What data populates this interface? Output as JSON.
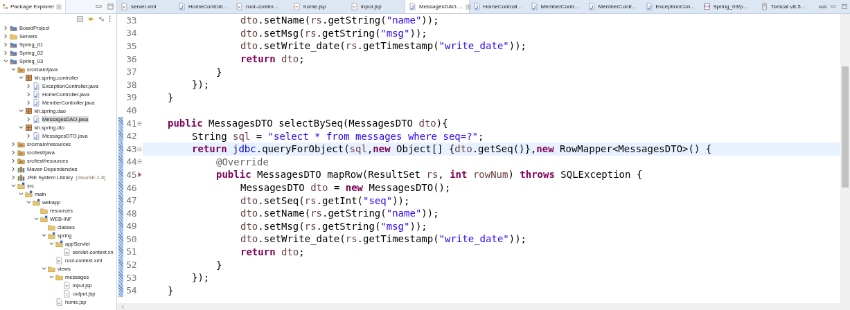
{
  "explorer": {
    "title": "Package Explorer",
    "tree": [
      {
        "label": "BoardProject",
        "kind": "project",
        "expanded": false,
        "selected": false
      },
      {
        "label": "Servers",
        "kind": "folder",
        "expanded": false,
        "selected": false
      },
      {
        "label": "Spring_01",
        "kind": "project",
        "expanded": false,
        "selected": false
      },
      {
        "label": "Spring_02",
        "kind": "project",
        "expanded": false,
        "selected": false
      },
      {
        "label": "Spring_03",
        "kind": "project",
        "expanded": true,
        "selected": false,
        "children": [
          {
            "label": "src/main/java",
            "kind": "source",
            "expanded": true,
            "selected": false,
            "children": [
              {
                "label": "kh.spring.controller",
                "kind": "package",
                "expanded": true,
                "selected": false,
                "children": [
                  {
                    "label": "ExceptionController.java",
                    "kind": "java",
                    "expanded": false,
                    "selected": false
                  },
                  {
                    "label": "HomeController.java",
                    "kind": "java",
                    "expanded": false,
                    "selected": false
                  },
                  {
                    "label": "MemberController.java",
                    "kind": "java",
                    "expanded": false,
                    "selected": false
                  }
                ]
              },
              {
                "label": "kh.spring.dao",
                "kind": "package",
                "expanded": true,
                "selected": false,
                "children": [
                  {
                    "label": "MessagesDAO.java",
                    "kind": "java",
                    "expanded": false,
                    "selected": true
                  }
                ]
              },
              {
                "label": "kh.spring.dto",
                "kind": "package",
                "expanded": true,
                "selected": false,
                "children": [
                  {
                    "label": "MessagesDTO.java",
                    "kind": "java",
                    "expanded": false,
                    "selected": false
                  }
                ]
              }
            ]
          },
          {
            "label": "src/main/resources",
            "kind": "source",
            "expanded": false,
            "selected": false
          },
          {
            "label": "src/test/java",
            "kind": "source",
            "expanded": false,
            "selected": false
          },
          {
            "label": "src/test/resources",
            "kind": "source",
            "expanded": false,
            "selected": false
          },
          {
            "label": "Maven Dependencies",
            "kind": "library",
            "expanded": false,
            "selected": false
          },
          {
            "label": "JRE System Library",
            "note": "[JavaSE-1.8]",
            "kind": "library",
            "expanded": false,
            "selected": false
          },
          {
            "label": "src",
            "kind": "webfolder",
            "expanded": true,
            "selected": false,
            "children": [
              {
                "label": "main",
                "kind": "webfolder",
                "expanded": true,
                "selected": false,
                "children": [
                  {
                    "label": "webapp",
                    "kind": "webfolder",
                    "expanded": true,
                    "selected": false,
                    "children": [
                      {
                        "label": "resources",
                        "kind": "folder",
                        "selected": false
                      },
                      {
                        "label": "WEB-INF",
                        "kind": "webfolder",
                        "expanded": true,
                        "selected": false,
                        "children": [
                          {
                            "label": "classes",
                            "kind": "folder",
                            "selected": false
                          },
                          {
                            "label": "spring",
                            "kind": "webfolder",
                            "expanded": true,
                            "selected": false,
                            "children": [
                              {
                                "label": "appServlet",
                                "kind": "webfolder",
                                "expanded": true,
                                "selected": false,
                                "children": [
                                  {
                                    "label": "servlet-context.xn",
                                    "kind": "xml",
                                    "selected": false
                                  }
                                ]
                              },
                              {
                                "label": "root-context.xml",
                                "kind": "xml",
                                "selected": false
                              }
                            ]
                          },
                          {
                            "label": "views",
                            "kind": "folder",
                            "expanded": true,
                            "selected": false,
                            "children": [
                              {
                                "label": "messages",
                                "kind": "folder",
                                "expanded": true,
                                "selected": false,
                                "children": [
                                  {
                                    "label": "input.jsp",
                                    "kind": "jsp",
                                    "selected": false
                                  },
                                  {
                                    "label": "output.jsp",
                                    "kind": "jsp",
                                    "selected": false
                                  }
                                ]
                              },
                              {
                                "label": "home.jsp",
                                "kind": "jsp",
                                "selected": false
                              }
                            ]
                          }
                        ]
                      }
                    ]
                  }
                ]
              }
            ]
          }
        ]
      }
    ]
  },
  "editor": {
    "tabs": [
      {
        "label": "server.xml",
        "kind": "xml",
        "selected": false
      },
      {
        "label": "HomeControll...",
        "kind": "java",
        "selected": false
      },
      {
        "label": "root-contex...",
        "kind": "xml",
        "selected": false
      },
      {
        "label": "home.jsp",
        "kind": "jsp",
        "selected": false
      },
      {
        "label": "input.jsp",
        "kind": "jsp",
        "selected": false
      },
      {
        "label": "MessagesDAO....",
        "kind": "java",
        "selected": true
      },
      {
        "label": "HomeControll...",
        "kind": "java",
        "selected": false
      },
      {
        "label": "MemberContr...",
        "kind": "java",
        "selected": false
      },
      {
        "label": "MemberContr...",
        "kind": "java",
        "selected": false
      },
      {
        "label": "ExceptionCon...",
        "kind": "java",
        "selected": false
      },
      {
        "label": "Spring_03/p...",
        "kind": "maven",
        "selected": false
      },
      {
        "label": "Tomcat v8.5...",
        "kind": "server",
        "selected": false
      }
    ],
    "overflow": {
      "glyph": "»",
      "count": "29"
    },
    "lines": [
      {
        "number": "33",
        "current": false,
        "changed": false,
        "foldable": false,
        "overrides": false,
        "tokens": [
          {
            "kind": "var",
            "text": "\t\t\t\tdto"
          },
          {
            "kind": "plain",
            "text": ".setName("
          },
          {
            "kind": "var",
            "text": "rs"
          },
          {
            "kind": "plain",
            "text": ".getString("
          },
          {
            "kind": "str",
            "text": "\"name\""
          },
          {
            "kind": "plain",
            "text": "));"
          }
        ]
      },
      {
        "number": "34",
        "current": false,
        "changed": false,
        "foldable": false,
        "overrides": false,
        "tokens": [
          {
            "kind": "var",
            "text": "\t\t\t\tdto"
          },
          {
            "kind": "plain",
            "text": ".setMsg("
          },
          {
            "kind": "var",
            "text": "rs"
          },
          {
            "kind": "plain",
            "text": ".getString("
          },
          {
            "kind": "str",
            "text": "\"msg\""
          },
          {
            "kind": "plain",
            "text": "));"
          }
        ]
      },
      {
        "number": "35",
        "current": false,
        "changed": false,
        "foldable": false,
        "overrides": false,
        "tokens": [
          {
            "kind": "var",
            "text": "\t\t\t\tdto"
          },
          {
            "kind": "plain",
            "text": ".setWrite_date("
          },
          {
            "kind": "var",
            "text": "rs"
          },
          {
            "kind": "plain",
            "text": ".getTimestamp("
          },
          {
            "kind": "str",
            "text": "\"write_date\""
          },
          {
            "kind": "plain",
            "text": "));"
          }
        ]
      },
      {
        "number": "36",
        "current": false,
        "changed": false,
        "foldable": false,
        "overrides": false,
        "tokens": [
          {
            "kind": "kw",
            "text": "\t\t\t\treturn "
          },
          {
            "kind": "var",
            "text": "dto"
          },
          {
            "kind": "plain",
            "text": ";"
          }
        ]
      },
      {
        "number": "37",
        "current": false,
        "changed": false,
        "foldable": false,
        "overrides": false,
        "tokens": [
          {
            "kind": "plain",
            "text": "\t\t\t}"
          }
        ]
      },
      {
        "number": "38",
        "current": false,
        "changed": false,
        "foldable": false,
        "overrides": false,
        "tokens": [
          {
            "kind": "plain",
            "text": "\t\t});"
          }
        ]
      },
      {
        "number": "39",
        "current": false,
        "changed": false,
        "foldable": false,
        "overrides": false,
        "tokens": [
          {
            "kind": "plain",
            "text": "\t}"
          }
        ]
      },
      {
        "number": "40",
        "current": false,
        "changed": false,
        "foldable": false,
        "overrides": false
      },
      {
        "number": "41",
        "current": false,
        "changed": true,
        "foldable": true,
        "overrides": false,
        "tokens": [
          {
            "kind": "kw",
            "text": "\tpublic"
          },
          {
            "kind": "plain",
            "text": " MessagesDTO selectBySeq(MessagesDTO "
          },
          {
            "kind": "var",
            "text": "dto"
          },
          {
            "kind": "plain",
            "text": "){"
          }
        ]
      },
      {
        "number": "42",
        "current": false,
        "changed": true,
        "foldable": false,
        "overrides": false,
        "tokens": [
          {
            "kind": "plain",
            "text": "\t\tString "
          },
          {
            "kind": "var",
            "text": "sql"
          },
          {
            "kind": "plain",
            "text": " = "
          },
          {
            "kind": "str",
            "text": "\"select * from messages where seq=?\""
          },
          {
            "kind": "plain",
            "text": ";"
          }
        ]
      },
      {
        "number": "43",
        "current": true,
        "changed": true,
        "foldable": true,
        "overrides": false,
        "tokens": [
          {
            "kind": "kw",
            "text": "\t\treturn "
          },
          {
            "kind": "field",
            "text": "jdbc"
          },
          {
            "kind": "plain",
            "text": ".queryForObject("
          },
          {
            "kind": "var",
            "text": "sql"
          },
          {
            "kind": "plain",
            "text": ","
          },
          {
            "kind": "kw",
            "text": "new"
          },
          {
            "kind": "plain",
            "text": " Object[] {"
          },
          {
            "kind": "var",
            "text": "dto"
          },
          {
            "kind": "plain",
            "text": ".getSeq()},"
          },
          {
            "kind": "kw",
            "text": "new"
          },
          {
            "kind": "plain",
            "text": " RowMapper<MessagesDTO>() {"
          }
        ]
      },
      {
        "number": "44",
        "current": false,
        "changed": true,
        "foldable": true,
        "overrides": false,
        "tokens": [
          {
            "kind": "ann",
            "text": "\t\t\t@Override"
          }
        ]
      },
      {
        "number": "45",
        "current": false,
        "changed": true,
        "foldable": false,
        "overrides": true,
        "tokens": [
          {
            "kind": "kw",
            "text": "\t\t\tpublic"
          },
          {
            "kind": "plain",
            "text": " MessagesDTO mapRow(ResultSet "
          },
          {
            "kind": "var",
            "text": "rs"
          },
          {
            "kind": "plain",
            "text": ", "
          },
          {
            "kind": "kw",
            "text": "int "
          },
          {
            "kind": "var",
            "text": "rowNum"
          },
          {
            "kind": "plain",
            "text": ") "
          },
          {
            "kind": "kw",
            "text": "throws"
          },
          {
            "kind": "plain",
            "text": " SQLException {"
          }
        ]
      },
      {
        "number": "46",
        "current": false,
        "changed": true,
        "foldable": false,
        "overrides": false,
        "tokens": [
          {
            "kind": "plain",
            "text": "\t\t\t\tMessagesDTO "
          },
          {
            "kind": "var",
            "text": "dto"
          },
          {
            "kind": "plain",
            "text": " = "
          },
          {
            "kind": "kw",
            "text": "new"
          },
          {
            "kind": "plain",
            "text": " MessagesDTO();"
          }
        ]
      },
      {
        "number": "47",
        "current": false,
        "changed": true,
        "foldable": false,
        "overrides": false,
        "tokens": [
          {
            "kind": "var",
            "text": "\t\t\t\tdto"
          },
          {
            "kind": "plain",
            "text": ".setSeq("
          },
          {
            "kind": "var",
            "text": "rs"
          },
          {
            "kind": "plain",
            "text": ".getInt("
          },
          {
            "kind": "str",
            "text": "\"seq\""
          },
          {
            "kind": "plain",
            "text": "));"
          }
        ]
      },
      {
        "number": "48",
        "current": false,
        "changed": true,
        "foldable": false,
        "overrides": false,
        "tokens": [
          {
            "kind": "var",
            "text": "\t\t\t\tdto"
          },
          {
            "kind": "plain",
            "text": ".setName("
          },
          {
            "kind": "var",
            "text": "rs"
          },
          {
            "kind": "plain",
            "text": ".getString("
          },
          {
            "kind": "str",
            "text": "\"name\""
          },
          {
            "kind": "plain",
            "text": "));"
          }
        ]
      },
      {
        "number": "49",
        "current": false,
        "changed": true,
        "foldable": false,
        "overrides": false,
        "tokens": [
          {
            "kind": "var",
            "text": "\t\t\t\tdto"
          },
          {
            "kind": "plain",
            "text": ".setMsg("
          },
          {
            "kind": "var",
            "text": "rs"
          },
          {
            "kind": "plain",
            "text": ".getString("
          },
          {
            "kind": "str",
            "text": "\"msg\""
          },
          {
            "kind": "plain",
            "text": "));"
          }
        ]
      },
      {
        "number": "50",
        "current": false,
        "changed": true,
        "foldable": false,
        "overrides": false,
        "tokens": [
          {
            "kind": "var",
            "text": "\t\t\t\tdto"
          },
          {
            "kind": "plain",
            "text": ".setWrite_date("
          },
          {
            "kind": "var",
            "text": "rs"
          },
          {
            "kind": "plain",
            "text": ".getTimestamp("
          },
          {
            "kind": "str",
            "text": "\"write_date\""
          },
          {
            "kind": "plain",
            "text": "));"
          }
        ]
      },
      {
        "number": "51",
        "current": false,
        "changed": true,
        "foldable": false,
        "overrides": false,
        "tokens": [
          {
            "kind": "kw",
            "text": "\t\t\t\treturn "
          },
          {
            "kind": "var",
            "text": "dto"
          },
          {
            "kind": "plain",
            "text": ";"
          }
        ]
      },
      {
        "number": "52",
        "current": false,
        "changed": true,
        "foldable": false,
        "overrides": false,
        "tokens": [
          {
            "kind": "plain",
            "text": "\t\t\t}"
          }
        ]
      },
      {
        "number": "53",
        "current": false,
        "changed": true,
        "foldable": false,
        "overrides": false,
        "tokens": [
          {
            "kind": "plain",
            "text": "\t\t});"
          }
        ]
      },
      {
        "number": "54",
        "current": false,
        "changed": true,
        "foldable": false,
        "overrides": false,
        "tokens": [
          {
            "kind": "plain",
            "text": "\t}"
          }
        ]
      }
    ]
  }
}
